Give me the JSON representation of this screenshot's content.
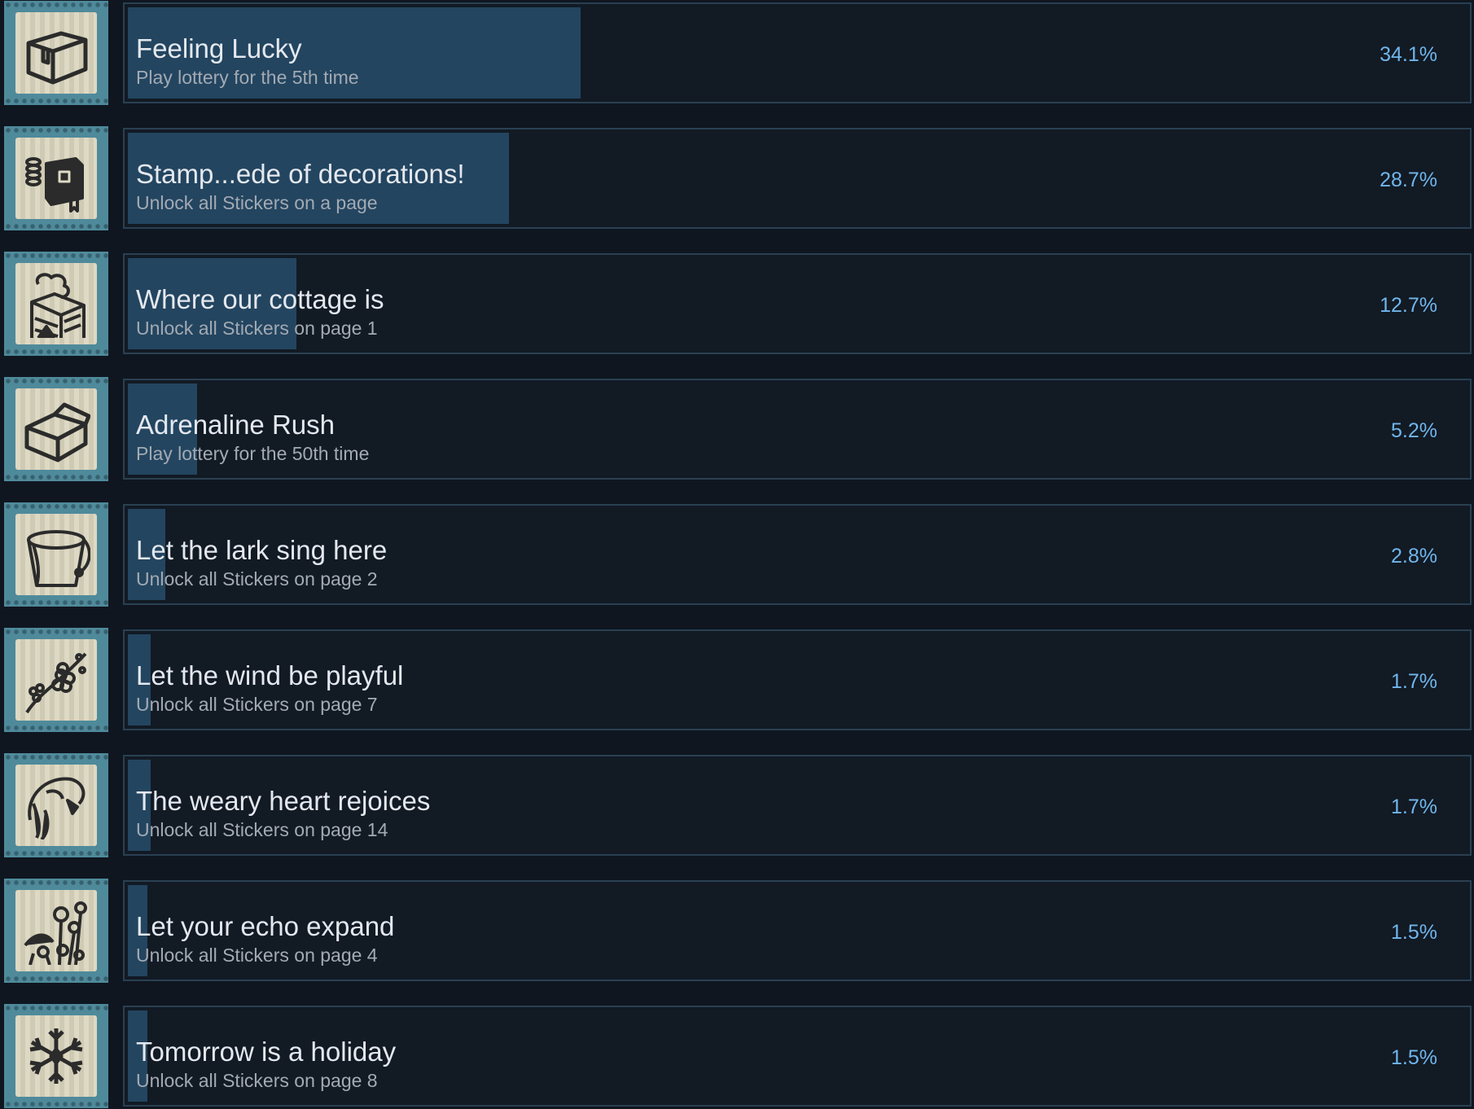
{
  "achievements": [
    {
      "title": "Feeling Lucky",
      "description": "Play lottery for the 5th time",
      "percent_label": "34.1%",
      "percent": 34.1,
      "icon": "box-icon"
    },
    {
      "title": "Stamp...ede of decorations!",
      "description": "Unlock all Stickers on a page",
      "percent_label": "28.7%",
      "percent": 28.7,
      "icon": "book-coins-icon"
    },
    {
      "title": "Where our cottage is",
      "description": "Unlock all Stickers on page 1",
      "percent_label": "12.7%",
      "percent": 12.7,
      "icon": "chimney-icon"
    },
    {
      "title": "Adrenaline Rush",
      "description": "Play lottery for the 50th time",
      "percent_label": "5.2%",
      "percent": 5.2,
      "icon": "open-box-icon"
    },
    {
      "title": "Let the lark sing here",
      "description": "Unlock all Stickers on page 2",
      "percent_label": "2.8%",
      "percent": 2.8,
      "icon": "bucket-icon"
    },
    {
      "title": "Let the wind be playful",
      "description": "Unlock all Stickers on page 7",
      "percent_label": "1.7%",
      "percent": 1.7,
      "icon": "blossom-branch-icon"
    },
    {
      "title": "The weary heart rejoices",
      "description": "Unlock all Stickers on page 14",
      "percent_label": "1.7%",
      "percent": 1.7,
      "icon": "bellflower-icon"
    },
    {
      "title": "Let your echo expand",
      "description": "Unlock all Stickers on page 4",
      "percent_label": "1.5%",
      "percent": 1.5,
      "icon": "wildflowers-icon"
    },
    {
      "title": "Tomorrow is a holiday",
      "description": "Unlock all Stickers on page 8",
      "percent_label": "1.5%",
      "percent": 1.5,
      "icon": "snowflake-icon"
    }
  ]
}
